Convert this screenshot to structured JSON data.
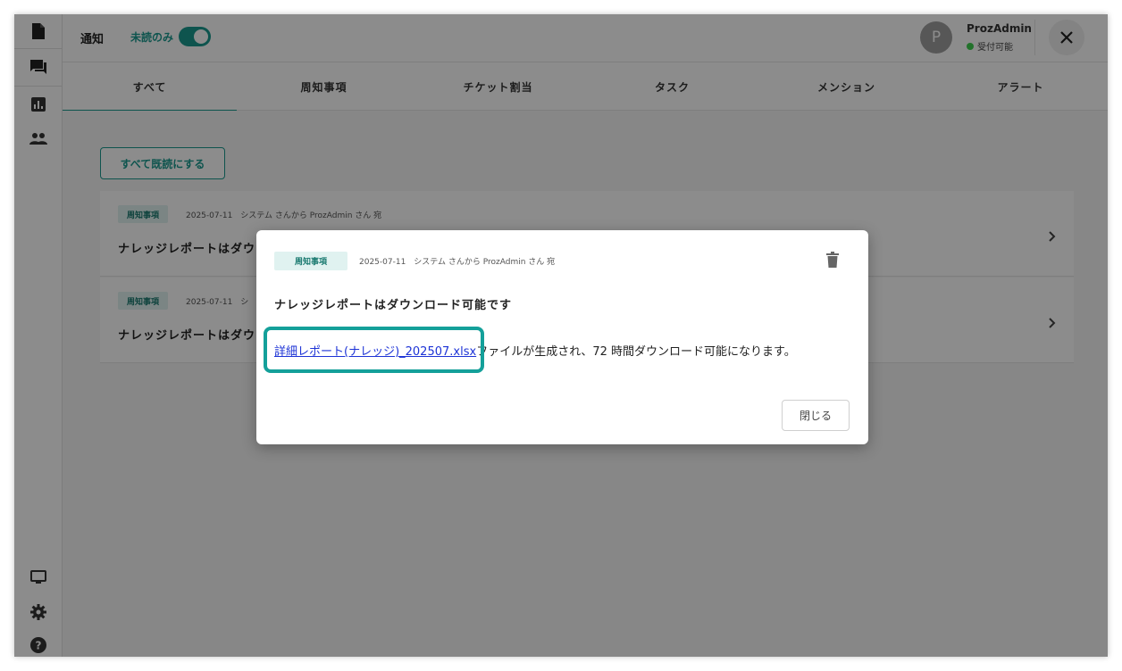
{
  "header": {
    "title": "通知",
    "unread_only_label": "未読のみ",
    "unread_only_on": true
  },
  "user": {
    "avatar_initial": "P",
    "name": "ProzAdmin",
    "status": "受付可能",
    "status_color": "#3ecf4f"
  },
  "sidebar": {
    "icons": [
      "document-icon",
      "chat-icon",
      "report-icon",
      "users-icon",
      "monitor-icon",
      "gear-icon",
      "help-icon"
    ]
  },
  "tabs": [
    {
      "label": "すべて",
      "active": true
    },
    {
      "label": "周知事項",
      "active": false
    },
    {
      "label": "チケット割当",
      "active": false
    },
    {
      "label": "タスク",
      "active": false
    },
    {
      "label": "メンション",
      "active": false
    },
    {
      "label": "アラート",
      "active": false
    }
  ],
  "mark_all_read_label": "すべて既読にする",
  "notifications": [
    {
      "tag": "周知事項",
      "meta": "2025-07-11　システム さんから ProzAdmin さん 宛",
      "title": "ナレッジレポートはダウン"
    },
    {
      "tag": "周知事項",
      "meta": "2025-07-11　シ",
      "title": "ナレッジレポートはダウン"
    }
  ],
  "modal": {
    "tag": "周知事項",
    "meta": "2025-07-11　システム さんから ProzAdmin さん 宛",
    "title": "ナレッジレポートはダウンロード可能です",
    "link_text": "詳細レポート(ナレッジ)_202507.xlsx",
    "body_text": "ファイルが生成され、72 時間ダウンロード可能になります。",
    "close_label": "閉じる"
  },
  "colors": {
    "accent": "#1a9a8f",
    "link": "#1d33d6",
    "highlight": "#14a09a"
  }
}
